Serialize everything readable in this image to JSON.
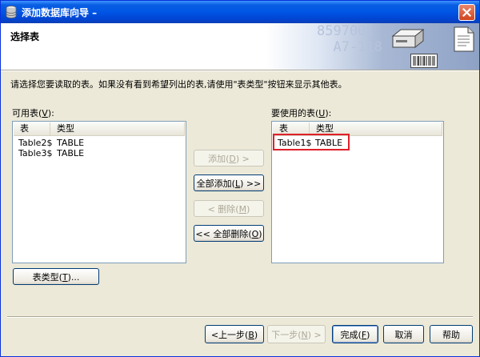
{
  "window": {
    "title": "添加数据库向导 –",
    "icon": "database-icon",
    "close_icon": "close-icon"
  },
  "header": {
    "title": "选择表",
    "deco_text": "8597001\n  A7-118",
    "illustration_icons": [
      "server-icon",
      "barcode-icon",
      "document-icon"
    ]
  },
  "instruction": "请选择您要读取的表。如果没有看到希望列出的表,请使用\"表类型\"按钮来显示其他表。",
  "available": {
    "label": "可用表(",
    "mnemonic": "V",
    "label_end": "):",
    "columns": [
      "表",
      "类型"
    ],
    "rows": [
      {
        "name": "Table2$",
        "type": "TABLE"
      },
      {
        "name": "Table3$",
        "type": "TABLE"
      }
    ]
  },
  "selected": {
    "label": "要使用的表(",
    "mnemonic": "U",
    "label_end": "):",
    "columns": [
      "表",
      "类型"
    ],
    "rows": [
      {
        "name": "Table1$",
        "type": "TABLE"
      }
    ],
    "highlight_color": "#e0202a"
  },
  "buttons": {
    "add": {
      "pre": "添加(",
      "key": "D",
      "post": ") >"
    },
    "add_all": {
      "pre": "全部添加(",
      "key": "L",
      "post": ") >>"
    },
    "remove": {
      "pre": "< 删除(",
      "key": "M",
      "post": ")"
    },
    "remove_all": {
      "pre": "<< 全部删除(",
      "key": "O",
      "post": ")"
    },
    "table_type": {
      "pre": "表类型(",
      "key": "T",
      "post": ")..."
    },
    "back": {
      "pre": "<上一步(",
      "key": "B",
      "post": ")"
    },
    "next": {
      "pre": "下一步(",
      "key": "N",
      "post": ") >"
    },
    "finish": {
      "pre": "完成(",
      "key": "F",
      "post": ")"
    },
    "cancel": "取消",
    "help": "帮助"
  },
  "colors": {
    "titlebar": "#0055e5",
    "face": "#ece9d8",
    "list_border": "#7f9db9"
  }
}
